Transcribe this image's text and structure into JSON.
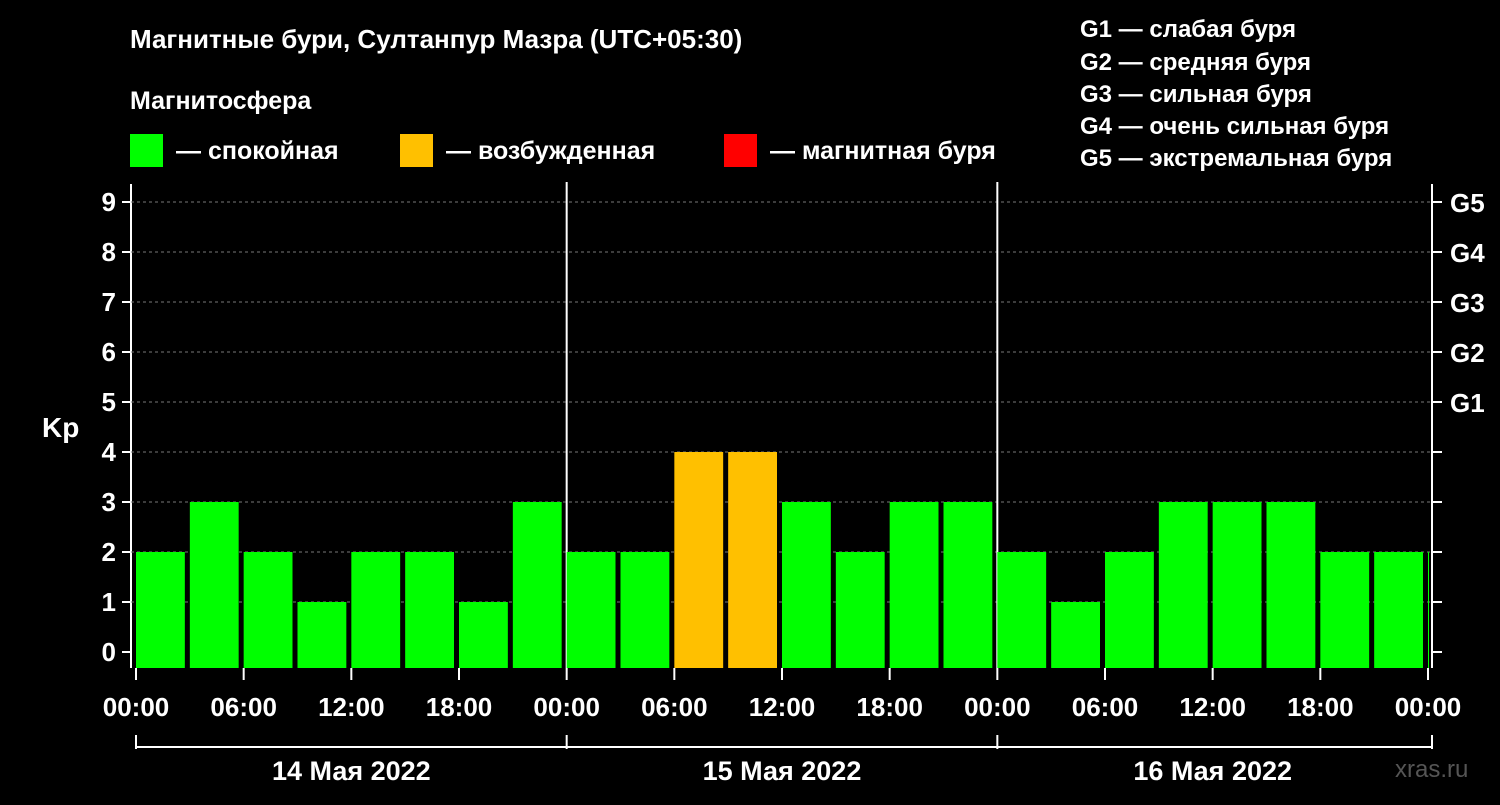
{
  "title": "Магнитные бури, Султанпур Мазра (UTC+05:30)",
  "legend_heading": "Магнитосфера",
  "legend": [
    {
      "label": "— спокойная",
      "color": "#00ff00"
    },
    {
      "label": "— возбужденная",
      "color": "#ffc000"
    },
    {
      "label": "— магнитная буря",
      "color": "#ff0000"
    }
  ],
  "g_scale": [
    "G1 — слабая буря",
    "G2 — средняя буря",
    "G3 — сильная буря",
    "G4 — очень сильная буря",
    "G5 — экстремальная буря"
  ],
  "watermark": "xras.ru",
  "chart_data": {
    "type": "bar",
    "ylabel": "Kp",
    "ylim": [
      0,
      9
    ],
    "yticks": [
      "0",
      "1",
      "2",
      "3",
      "4",
      "5",
      "6",
      "7",
      "8",
      "9"
    ],
    "right_axis_labels": [
      {
        "kp": 5,
        "label": "G1"
      },
      {
        "kp": 6,
        "label": "G2"
      },
      {
        "kp": 7,
        "label": "G3"
      },
      {
        "kp": 8,
        "label": "G4"
      },
      {
        "kp": 9,
        "label": "G5"
      }
    ],
    "xtick_labels": [
      "00:00",
      "06:00",
      "12:00",
      "18:00",
      "00:00",
      "06:00",
      "12:00",
      "18:00",
      "00:00",
      "06:00",
      "12:00",
      "18:00",
      "00:00"
    ],
    "day_labels": [
      "14 Мая 2022",
      "15 Мая 2022",
      "16 Мая 2022"
    ],
    "grid": true,
    "values": [
      2,
      3,
      2,
      1,
      2,
      2,
      1,
      3,
      2,
      2,
      4,
      4,
      3,
      2,
      3,
      3,
      2,
      1,
      2,
      3,
      3,
      3,
      2,
      2,
      2
    ],
    "colors": {
      "quiet": "#00ff00",
      "active": "#ffc000",
      "storm": "#ff0000"
    }
  }
}
